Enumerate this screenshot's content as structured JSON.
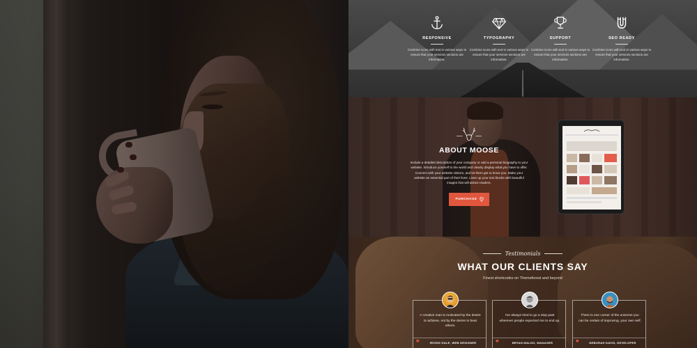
{
  "features": {
    "items": [
      {
        "icon": "anchor-icon",
        "title": "RESPONSIVE",
        "text": "Combine icons with text in various ways to ensure that your services sections are informative."
      },
      {
        "icon": "diamond-icon",
        "title": "TYPOGRAPHY",
        "text": "Combine icons with text in various ways to ensure that your services sections are informative."
      },
      {
        "icon": "trophy-icon",
        "title": "SUPPORT",
        "text": "Combine icons with text in various ways to ensure that your services sections are informative."
      },
      {
        "icon": "magnet-icon",
        "title": "SEO READY",
        "text": "Combine icons with text in various ways to ensure that your services sections are informative."
      }
    ]
  },
  "about": {
    "icon": "moose-antlers-icon",
    "title": "ABOUT MOOSE",
    "text": "Include a detailed description of your company or add a personal biography to your website. Introduce yourself to the world and cleanly display what you have to offer. Connect with your website visitors, and let them get to know you. Make your website an essential part of their lives. Liven up your text blocks with beautiful images that will attract readers.",
    "button_label": "PURCHASE",
    "button_icon": "map-pin-icon",
    "accent": "#e1573e"
  },
  "testimonials": {
    "script_label": "Testimonials",
    "title": "WHAT OUR CLIENTS SAY",
    "subtitle": "Finest shortcodes on Themeforest and beyond",
    "cards": [
      {
        "text": "A creative man is motivated by the desire to achieve, not by the desire to beat others.",
        "author": "IRVING HALE, WEB DESIGNER"
      },
      {
        "text": "I've always tried to go a step past wherever people expected me to end up.",
        "author": "BRYAN MALDO, MANAGER"
      },
      {
        "text": "There is one corner of the universe you can be certain of improving, your own self.",
        "author": "DEBORAH DAVIS, DEVELOPER"
      }
    ]
  }
}
